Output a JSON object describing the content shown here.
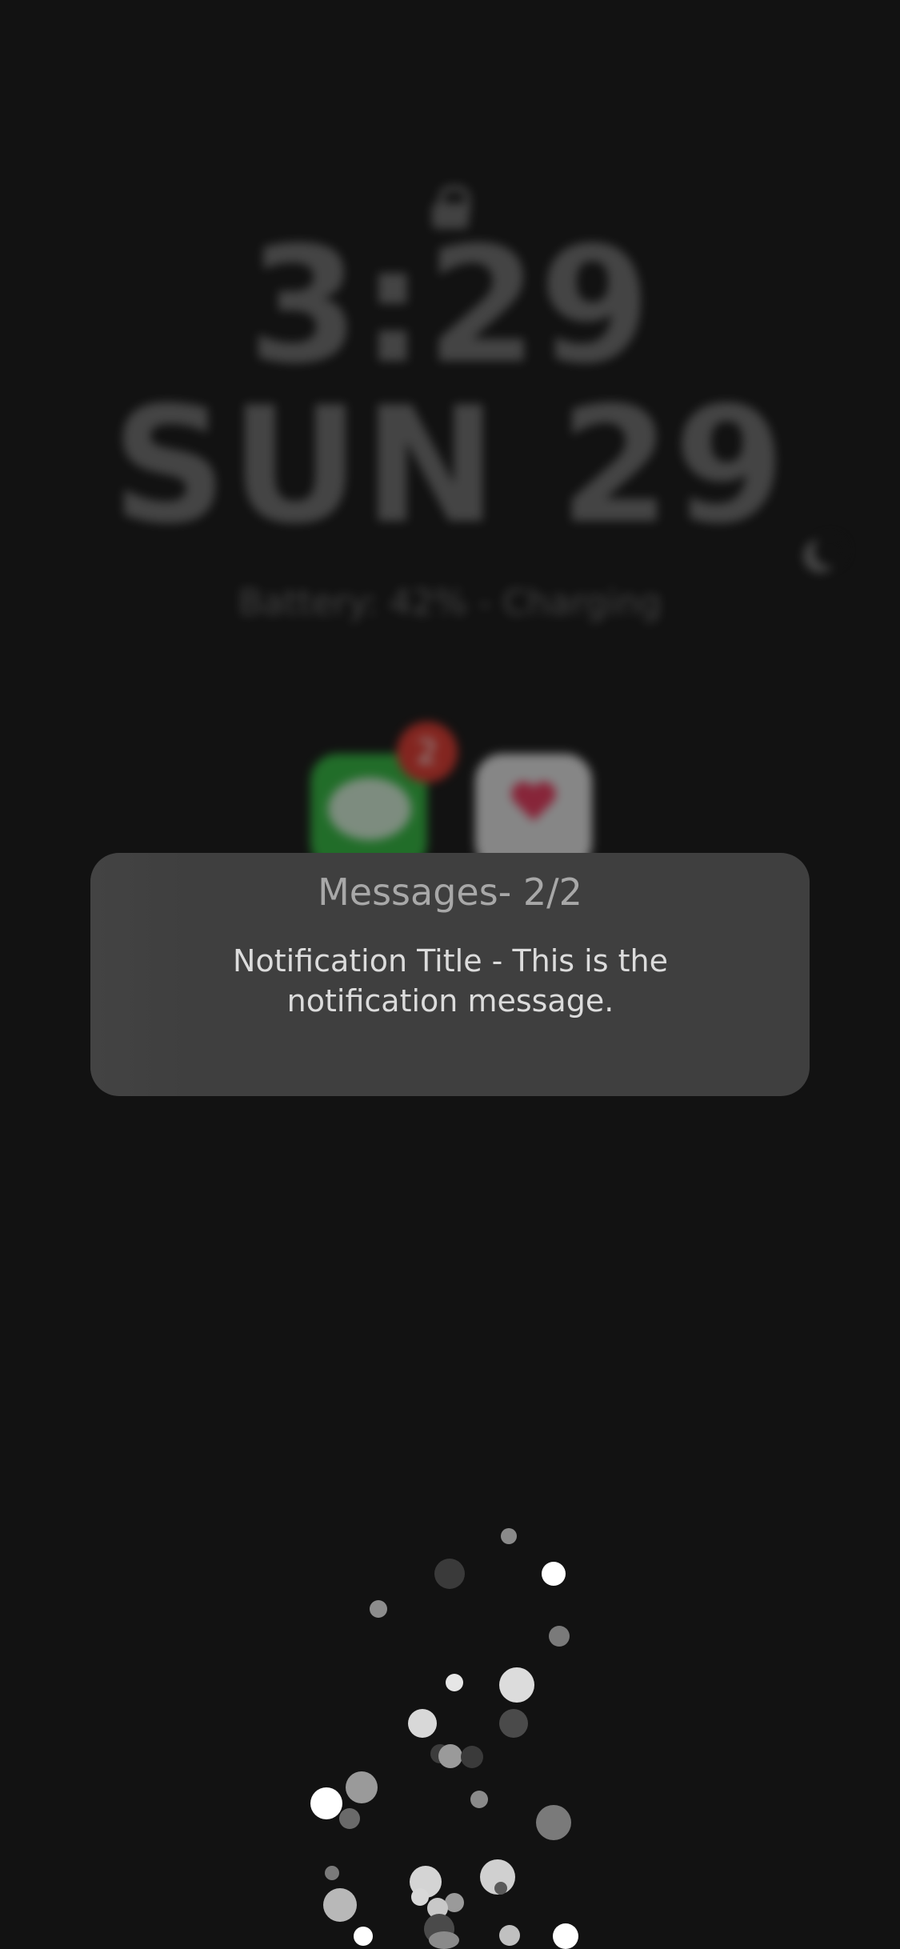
{
  "lock_screen": {
    "time": "3:29",
    "date": "SUN 29",
    "battery_label": "Battery:",
    "battery_value": "42% - Charging",
    "icons": [
      "lock-icon",
      "moon-icon"
    ]
  },
  "apps": [
    {
      "name": "Messages",
      "icon": "messages-icon",
      "badge": "2",
      "color": "#2fb83d"
    },
    {
      "name": "Health",
      "icon": "heart-icon",
      "color": "#e6e6e6"
    }
  ],
  "notification": {
    "header": "Messages- 2/2",
    "message": "Notification Title - This is the notification message."
  },
  "colors": {
    "background": "#121212",
    "notification_bg": "#3f3f3f",
    "badge": "#e0362c",
    "heart": "#e8365a"
  }
}
